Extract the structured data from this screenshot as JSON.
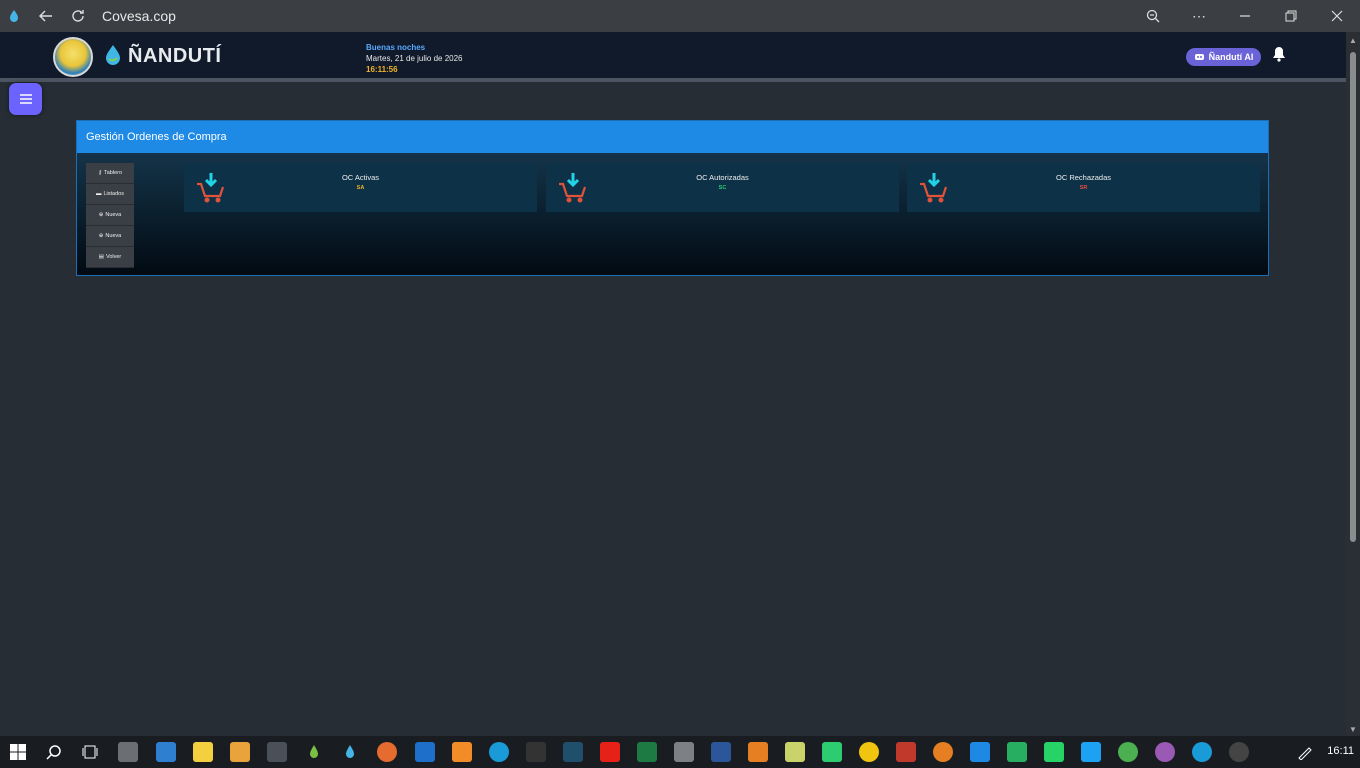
{
  "browser": {
    "title": "Covesa.cop"
  },
  "header": {
    "brand": "ÑANDUTÍ",
    "greeting": "Buenas noches",
    "date": "Martes, 21 de julio de 2026",
    "time": "16:11:56",
    "ai_button": "Ñandutí AI"
  },
  "panel": {
    "title": "Gestión Ordenes de Compra",
    "menu": [
      {
        "icon": "key-icon",
        "glyph": "⚷",
        "label": "Tablero"
      },
      {
        "icon": "card-icon",
        "glyph": "▬",
        "label": "Listados"
      },
      {
        "icon": "plus-circle-icon",
        "glyph": "⊕",
        "label": "Nueva"
      },
      {
        "icon": "plus-circle-icon",
        "glyph": "⊕",
        "label": "Nueva"
      },
      {
        "icon": "book-icon",
        "glyph": "▤",
        "label": "Volver"
      }
    ],
    "cards": [
      {
        "label": "OC Activas",
        "code": "SA",
        "code_color": "#f0b429"
      },
      {
        "label": "OC Autorizadas",
        "code": "SC",
        "code_color": "#2ecc71"
      },
      {
        "label": "OC Rechazadas",
        "code": "SR",
        "code_color": "#e74c3c"
      }
    ]
  },
  "taskbar": {
    "clock": "16:11"
  },
  "colors": {
    "accent": "#1e8ae6",
    "ai_button": "#6a63d8",
    "hamburger": "#6c63ff"
  }
}
